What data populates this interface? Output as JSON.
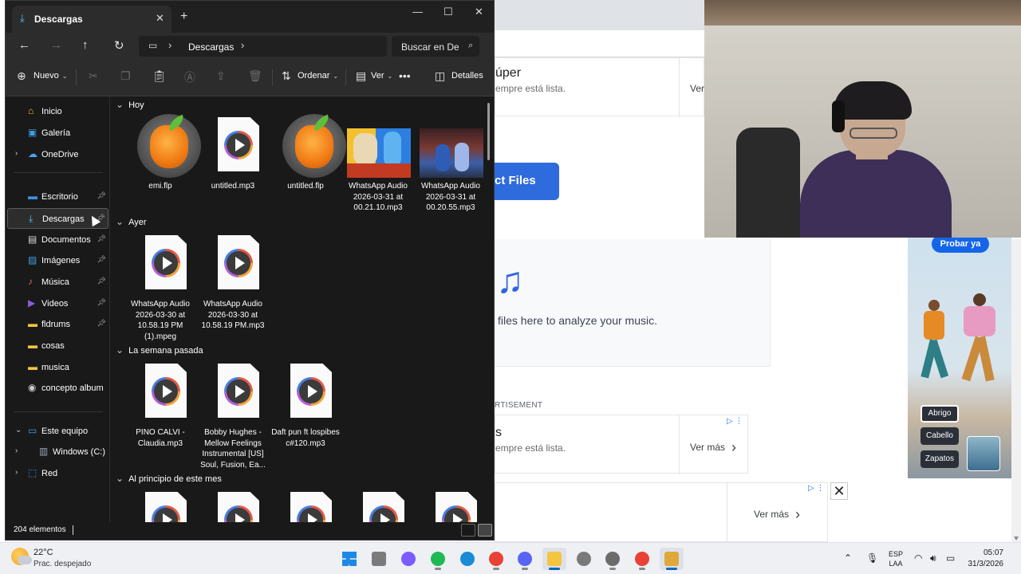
{
  "explorer": {
    "tab_title": "Descargas",
    "breadcrumb": "Descargas",
    "search_placeholder": "Buscar en Descargas",
    "commands": {
      "new": "Nuevo",
      "sort": "Ordenar",
      "view": "Ver",
      "details": "Detalles"
    },
    "sidebar": {
      "items": [
        {
          "label": "Inicio",
          "icon": "home-icon",
          "color": "#f2c14e"
        },
        {
          "label": "Galería",
          "icon": "gallery-icon",
          "color": "#3f9fe0"
        },
        {
          "label": "OneDrive",
          "icon": "cloud-icon",
          "color": "#4aa3ff"
        },
        {
          "label": "Escritorio",
          "icon": "desktop-icon",
          "color": "#3f8fe0"
        },
        {
          "label": "Descargas",
          "icon": "download-icon",
          "color": "#4cc2ff"
        },
        {
          "label": "Documentos",
          "icon": "document-icon",
          "color": "#d8d8d8"
        },
        {
          "label": "Imágenes",
          "icon": "pictures-icon",
          "color": "#3f9fe0"
        },
        {
          "label": "Música",
          "icon": "music-icon",
          "color": "#e8684a"
        },
        {
          "label": "Videos",
          "icon": "video-icon",
          "color": "#8a5ad8"
        },
        {
          "label": "fldrums",
          "icon": "folder-icon",
          "color": "#f4c542"
        },
        {
          "label": "cosas",
          "icon": "folder-icon",
          "color": "#f4c542"
        },
        {
          "label": "musica",
          "icon": "folder-icon",
          "color": "#f4c542"
        },
        {
          "label": "concepto album",
          "icon": "disc-icon",
          "color": "#d0d0d0"
        },
        {
          "label": "Este equipo",
          "icon": "pc-icon",
          "color": "#3f9fe0"
        },
        {
          "label": "Windows (C:)",
          "icon": "drive-icon",
          "color": "#9ab"
        },
        {
          "label": "Red",
          "icon": "network-icon",
          "color": "#3f9fe0"
        }
      ]
    },
    "groups": [
      {
        "title": "Hoy",
        "files": [
          {
            "name": "emi.flp",
            "kind": "flp"
          },
          {
            "name": "untitled.mp3",
            "kind": "audio"
          },
          {
            "name": "untitled.flp",
            "kind": "flp"
          },
          {
            "name": "WhatsApp Audio 2026-03-31 at 00.21.10.mp3",
            "kind": "image-cartoon"
          },
          {
            "name": "WhatsApp Audio 2026-03-31 at 00.20.55.mp3",
            "kind": "image-crowd"
          }
        ]
      },
      {
        "title": "Ayer",
        "files": [
          {
            "name": "WhatsApp Audio 2026-03-30 at 10.58.19 PM (1).mpeg",
            "kind": "audio"
          },
          {
            "name": "WhatsApp Audio 2026-03-30 at 10.58.19 PM.mp3",
            "kind": "audio"
          }
        ]
      },
      {
        "title": "La semana pasada",
        "files": [
          {
            "name": "PINO CALVI - Claudia.mp3",
            "kind": "audio"
          },
          {
            "name": "Bobby Hughes - Mellow Feelings Instrumental [US] Soul, Fusion, Ea...",
            "kind": "audio"
          },
          {
            "name": "Daft pun ft lospibes c#120.mp3",
            "kind": "audio"
          }
        ]
      },
      {
        "title": "Al principio de este mes",
        "files": [
          {
            "name": "",
            "kind": "audio"
          },
          {
            "name": "",
            "kind": "audio"
          },
          {
            "name": "",
            "kind": "audio"
          },
          {
            "name": "",
            "kind": "audio"
          },
          {
            "name": "",
            "kind": "audio"
          }
        ]
      }
    ],
    "status": {
      "item_count": "204 elementos"
    }
  },
  "web": {
    "ad1": {
      "title": "úper",
      "subtitle": "empre está lista.",
      "link": "Ver"
    },
    "select_button": "ct Files",
    "drop_text": "files here to analyze your music.",
    "ad_label": "RTISEMENT",
    "ad2": {
      "title": "s",
      "subtitle": "empre está lista.",
      "link": "Ver más"
    },
    "ad3": {
      "link": "Ver más"
    },
    "fashion_ad": {
      "cta": "Probar ya",
      "chips": [
        "Abrigo",
        "Cabello",
        "Zapatos"
      ]
    }
  },
  "taskbar": {
    "weather": {
      "temp": "22°C",
      "condition": "Prac. despejado"
    },
    "apps": [
      {
        "name": "windows-start-icon",
        "color": "#1e88e5"
      },
      {
        "name": "task-view-icon",
        "color": "#7b7b7b"
      },
      {
        "name": "copilot-icon",
        "color": "#7a5cff"
      },
      {
        "name": "spotify-icon",
        "color": "#1db954"
      },
      {
        "name": "edge-icon",
        "color": "#1b8bd6"
      },
      {
        "name": "chrome-icon",
        "color": "#e94235"
      },
      {
        "name": "discord-icon",
        "color": "#5865f2"
      },
      {
        "name": "file-explorer-icon",
        "color": "#f4c542"
      },
      {
        "name": "fl-studio-icon",
        "color": "#7a7a7a"
      },
      {
        "name": "settings-icon",
        "color": "#6b6b6b"
      },
      {
        "name": "chrome-icon",
        "color": "#e94235"
      },
      {
        "name": "paint-icon",
        "color": "#e0a73b"
      }
    ],
    "tray": {
      "lang_top": "ESP",
      "lang_bottom": "LAA",
      "time": "05:07",
      "date": "31/3/2026"
    }
  }
}
